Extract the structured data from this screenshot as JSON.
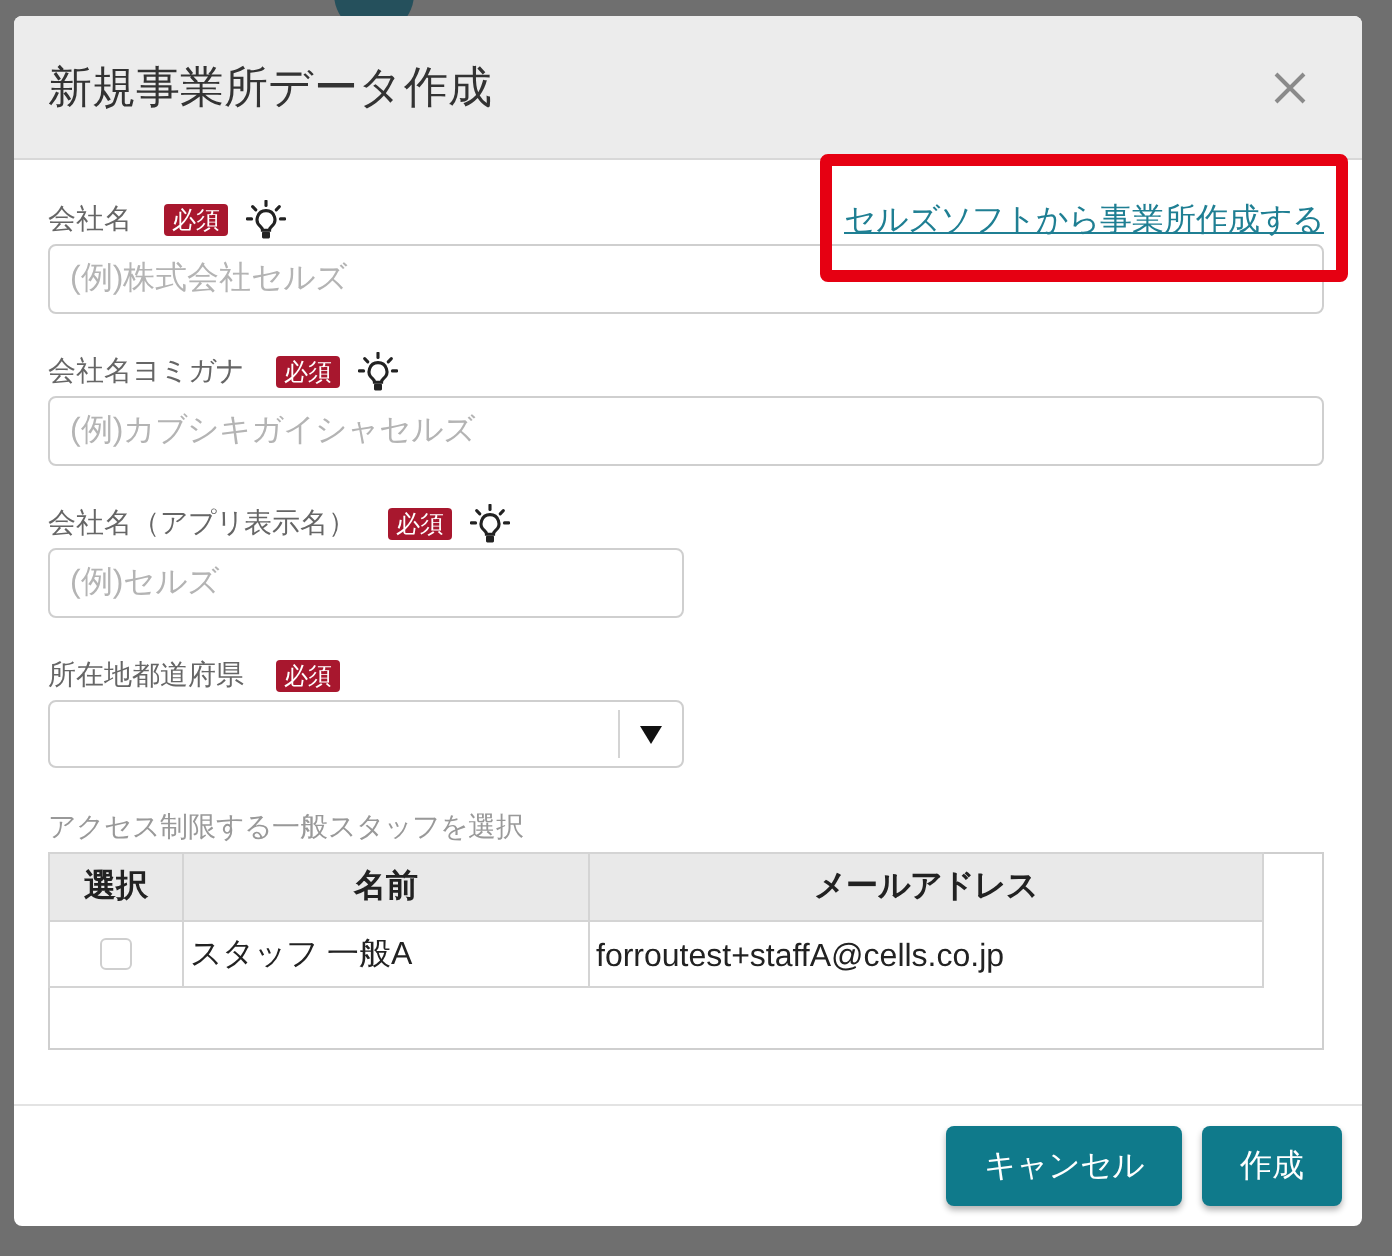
{
  "dialog": {
    "title": "新規事業所データ作成"
  },
  "source_link": "セルズソフトから事業所作成する",
  "fields": [
    {
      "kind": "text",
      "label": "会社名",
      "badge": "必須",
      "hint": true,
      "placeholder": "(例)株式会社セルズ"
    },
    {
      "kind": "text",
      "label": "会社名ヨミガナ",
      "badge": "必須",
      "hint": true,
      "placeholder": "(例)カブシキガイシャセルズ"
    },
    {
      "kind": "text",
      "label": "会社名（アプリ表示名）",
      "badge": "必須",
      "hint": true,
      "placeholder": "(例)セルズ"
    },
    {
      "kind": "select",
      "label": "所在地都道府県",
      "badge": "必須",
      "hint": false
    }
  ],
  "staff_table": {
    "caption": "アクセス制限する一般スタッフを選択",
    "columns": [
      "選択",
      "名前",
      "メールアドレス"
    ],
    "rows": [
      {
        "checked": false,
        "name": "スタッフ 一般A",
        "email": "forroutest+staffA@cells.co.jp"
      }
    ]
  },
  "buttons": [
    "キャンセル",
    "作成"
  ]
}
